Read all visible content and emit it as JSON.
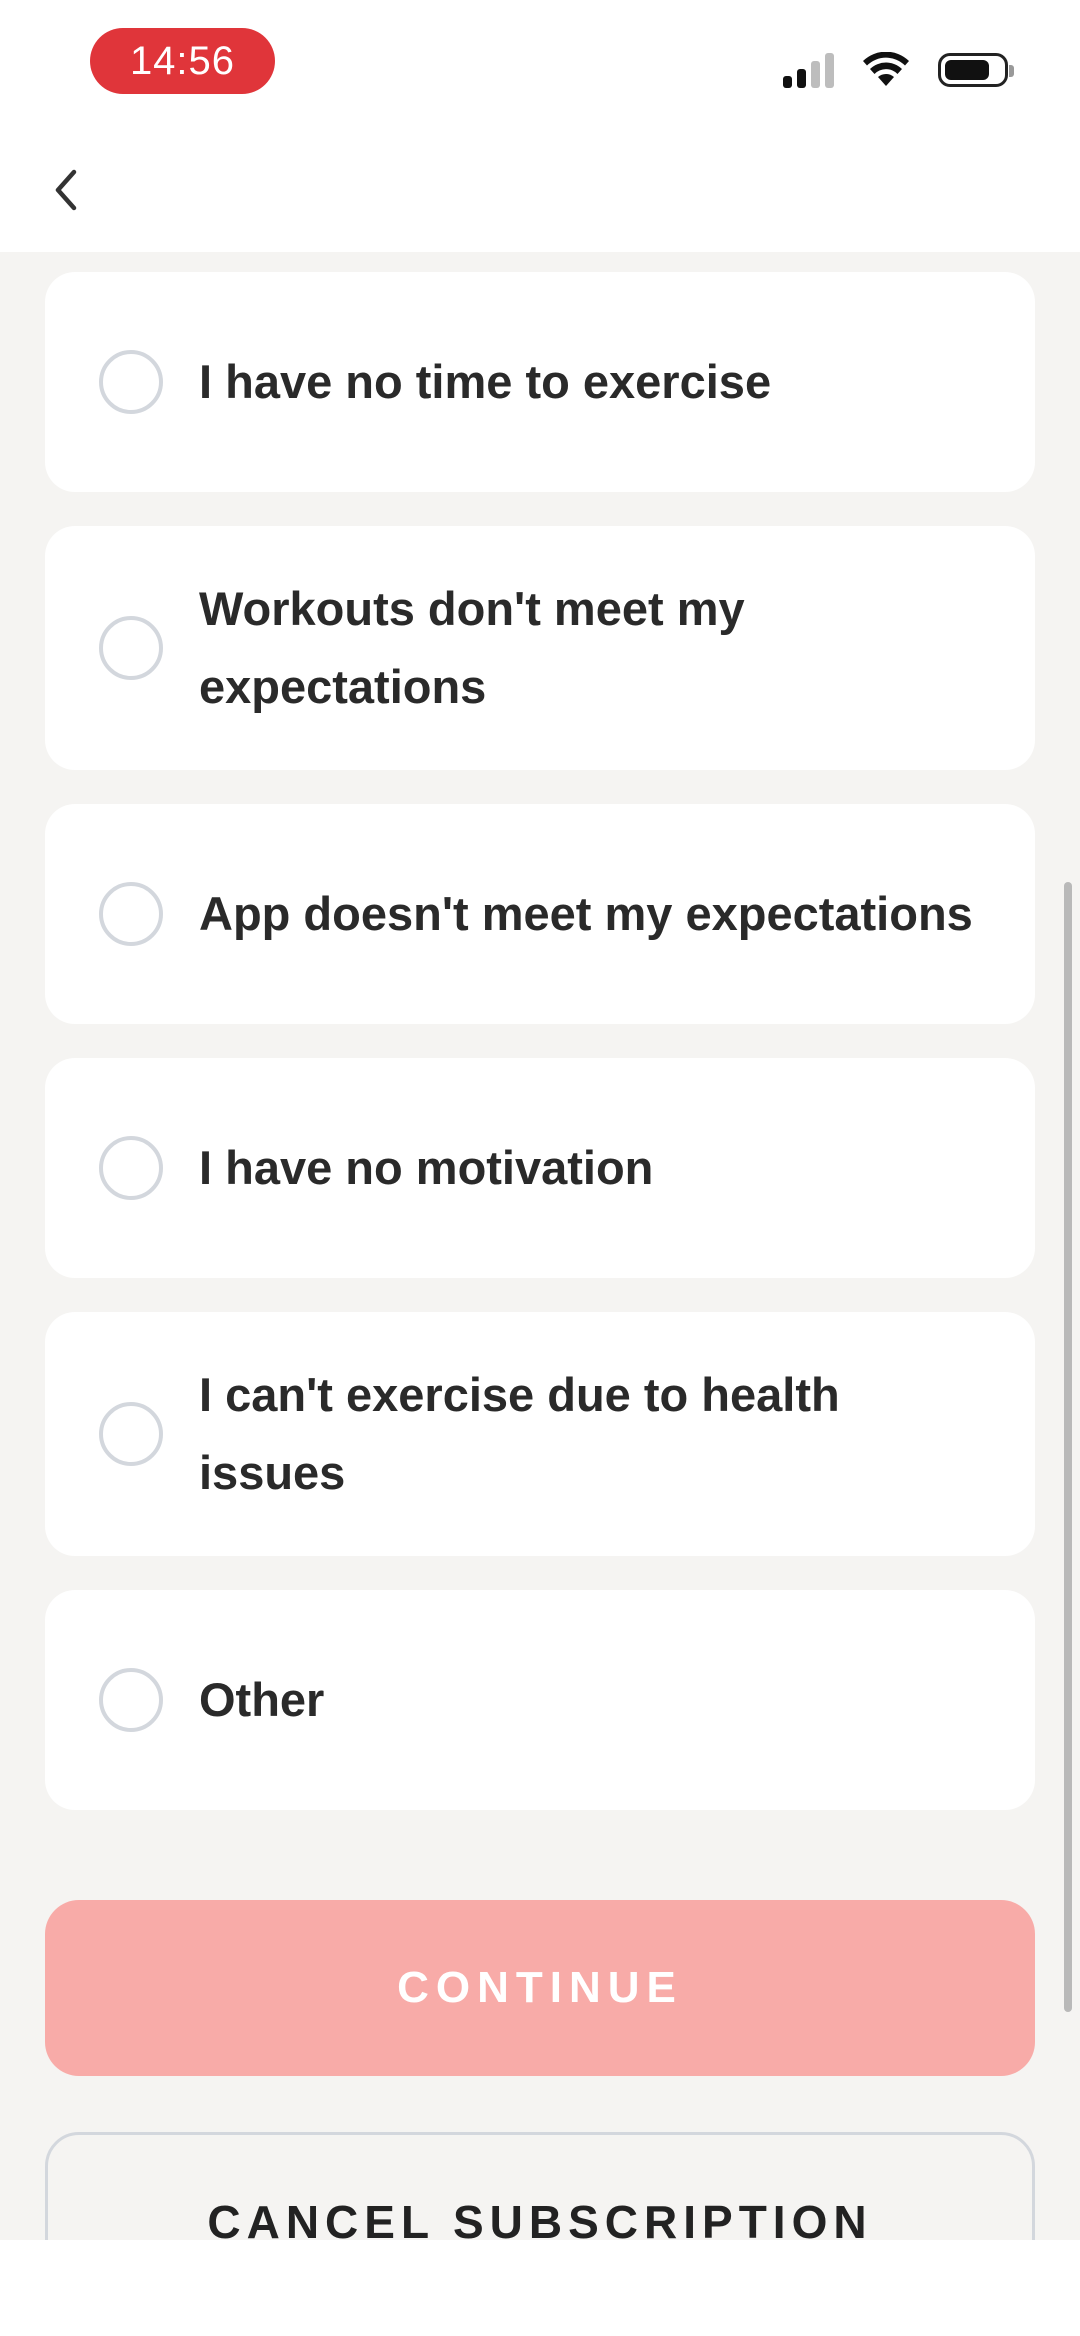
{
  "status_bar": {
    "time": "14:56",
    "icons": [
      "signal-icon",
      "wifi-icon",
      "battery-icon"
    ]
  },
  "nav": {
    "back_icon": "chevron-left-icon"
  },
  "options": [
    {
      "label": "I have no time to exercise"
    },
    {
      "label": "Workouts don't meet my expectations"
    },
    {
      "label": "App doesn't meet my expectations"
    },
    {
      "label": "I have no motivation"
    },
    {
      "label": "I can't exercise due to health issues"
    },
    {
      "label": "Other"
    }
  ],
  "actions": {
    "continue_label": "CONTINUE",
    "cancel_label": "CANCEL SUBSCRIPTION"
  },
  "colors": {
    "accent": "#f8aba8",
    "time_pill": "#e0353a",
    "background": "#f5f4f2"
  }
}
